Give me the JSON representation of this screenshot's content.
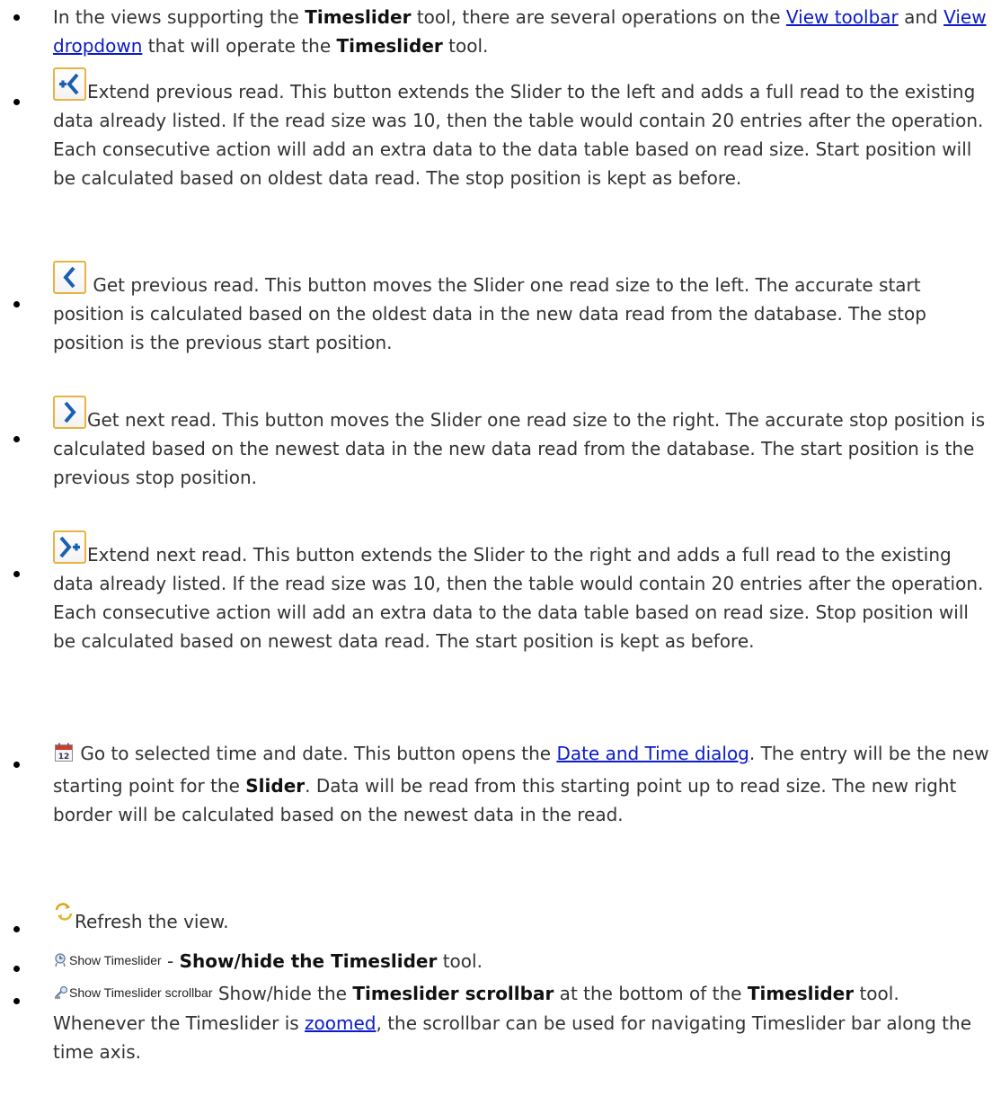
{
  "intro": {
    "t1": "In the views supporting the ",
    "b1": "Timeslider",
    "t2": " tool, there are several operations on the ",
    "link1": "View toolbar",
    "t3": " and ",
    "link2": "View dropdown",
    "t4": " that will operate the ",
    "b2": "Timeslider",
    "t5": " tool."
  },
  "extend_prev": {
    "icon": "extend-previous-icon",
    "text": "Extend previous read. This button extends the Slider to the left and adds a full read to the existing data already listed. If the read size was 10, then the table would contain 20 entries after the operation. Each consecutive action will add an extra data to the data table based on read size. Start position will be calculated based on oldest data read. The stop position is kept as before."
  },
  "get_prev": {
    "icon": "previous-icon",
    "text": " Get previous read. This button moves the Slider one read size to the left. The accurate start position is calculated based on the oldest data in the new data read from the database. The stop position is the previous start position."
  },
  "get_next": {
    "icon": "next-icon",
    "text": "Get next read. This button moves the Slider one read size to the right. The accurate stop position is calculated based on the newest data in the new data read from the database. The start position is the previous stop position."
  },
  "extend_next": {
    "icon": "extend-next-icon",
    "text": "Extend next read. This button extends the Slider to the right and adds a full read to the existing data already listed. If the read size was 10, then the table would contain 20 entries after the operation. Each consecutive action will add an extra data to the data table based on read size. Stop position will be calculated based on newest data read. The start position is kept as before."
  },
  "goto_date": {
    "icon": "calendar-icon",
    "t1": " Go to selected time and date. This button opens the ",
    "link": "Date and Time dialog",
    "t2": ". The entry will be the new starting point for the ",
    "b1": "Slider",
    "t3": ". Data will be read from this starting point up to read size. The new right border will be calculated based on the newest data in the read."
  },
  "refresh": {
    "icon": "refresh-icon",
    "text": "Refresh the view."
  },
  "show_timeslider": {
    "icon": "timeslider-icon",
    "label": "Show Timeslider",
    "t1": " - ",
    "b1": "Show/hide the Timeslider",
    "t2": " tool."
  },
  "show_scrollbar": {
    "icon": "timeslider-scrollbar-icon",
    "label": "Show Timeslider scrollbar",
    "t1": " Show/hide the ",
    "b1": "Timeslider scrollbar",
    "t2": " at the bottom of the ",
    "b2": "Timeslider",
    "t3": " tool. Whenever the Timeslider is ",
    "link": "zoomed",
    "t4": ", the scrollbar can be used for navigating Timeslider bar along the time axis."
  },
  "colors": {
    "text": "#333333",
    "link": "#0a1bc7",
    "icon_border": "#e8b341",
    "icon_glyph": "#1a5fb4"
  }
}
